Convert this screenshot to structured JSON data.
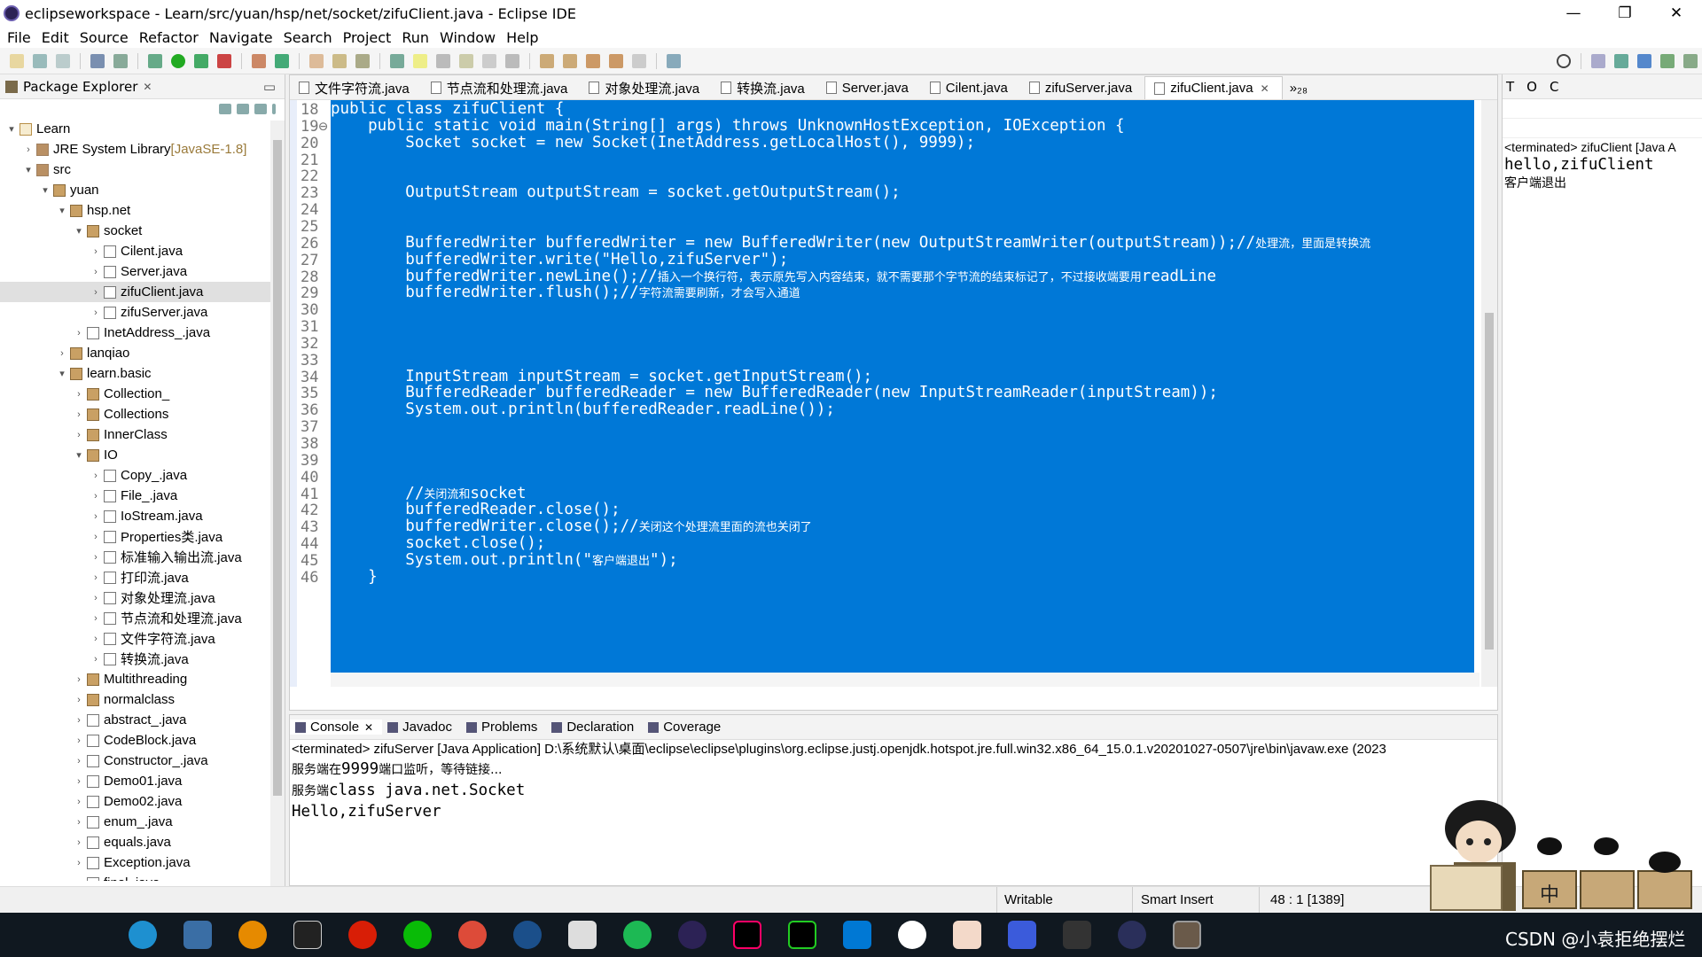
{
  "window": {
    "title": "eclipseworkspace - Learn/src/yuan/hsp/net/socket/zifuClient.java - Eclipse IDE",
    "minimize": "—",
    "restore": "❐",
    "close": "✕"
  },
  "menu": [
    "File",
    "Edit",
    "Source",
    "Refactor",
    "Navigate",
    "Search",
    "Project",
    "Run",
    "Window",
    "Help"
  ],
  "package_explorer": {
    "title": "Package Explorer",
    "items": [
      {
        "label": "Learn",
        "depth": 0,
        "arrow": "▾",
        "icon": "proj"
      },
      {
        "label": "JRE System Library",
        "suffix": " [JavaSE-1.8]",
        "depth": 1,
        "arrow": "›",
        "icon": "jre"
      },
      {
        "label": "src",
        "depth": 1,
        "arrow": "▾",
        "icon": "jre"
      },
      {
        "label": "yuan",
        "depth": 2,
        "arrow": "▾",
        "icon": "pkg"
      },
      {
        "label": "hsp.net",
        "depth": 3,
        "arrow": "▾",
        "icon": "pkg"
      },
      {
        "label": "socket",
        "depth": 4,
        "arrow": "▾",
        "icon": "pkg"
      },
      {
        "label": "Cilent.java",
        "depth": 5,
        "arrow": "›",
        "icon": "java"
      },
      {
        "label": "Server.java",
        "depth": 5,
        "arrow": "›",
        "icon": "java"
      },
      {
        "label": "zifuClient.java",
        "depth": 5,
        "arrow": "›",
        "icon": "java",
        "selected": true
      },
      {
        "label": "zifuServer.java",
        "depth": 5,
        "arrow": "›",
        "icon": "java"
      },
      {
        "label": "InetAddress_.java",
        "depth": 4,
        "arrow": "›",
        "icon": "java"
      },
      {
        "label": "lanqiao",
        "depth": 3,
        "arrow": "›",
        "icon": "pkg"
      },
      {
        "label": "learn.basic",
        "depth": 3,
        "arrow": "▾",
        "icon": "pkg"
      },
      {
        "label": "Collection_",
        "depth": 4,
        "arrow": "›",
        "icon": "pkg"
      },
      {
        "label": "Collections",
        "depth": 4,
        "arrow": "›",
        "icon": "pkg"
      },
      {
        "label": "InnerClass",
        "depth": 4,
        "arrow": "›",
        "icon": "pkg"
      },
      {
        "label": "IO",
        "depth": 4,
        "arrow": "▾",
        "icon": "pkg"
      },
      {
        "label": "Copy_.java",
        "depth": 5,
        "arrow": "›",
        "icon": "java"
      },
      {
        "label": "File_.java",
        "depth": 5,
        "arrow": "›",
        "icon": "java"
      },
      {
        "label": "IoStream.java",
        "depth": 5,
        "arrow": "›",
        "icon": "java"
      },
      {
        "label": "Properties类.java",
        "depth": 5,
        "arrow": "›",
        "icon": "java"
      },
      {
        "label": "标准输入输出流.java",
        "depth": 5,
        "arrow": "›",
        "icon": "java"
      },
      {
        "label": "打印流.java",
        "depth": 5,
        "arrow": "›",
        "icon": "java"
      },
      {
        "label": "对象处理流.java",
        "depth": 5,
        "arrow": "›",
        "icon": "java"
      },
      {
        "label": "节点流和处理流.java",
        "depth": 5,
        "arrow": "›",
        "icon": "java"
      },
      {
        "label": "文件字符流.java",
        "depth": 5,
        "arrow": "›",
        "icon": "java"
      },
      {
        "label": "转换流.java",
        "depth": 5,
        "arrow": "›",
        "icon": "java"
      },
      {
        "label": "Multithreading",
        "depth": 4,
        "arrow": "›",
        "icon": "pkg"
      },
      {
        "label": "normalclass",
        "depth": 4,
        "arrow": "›",
        "icon": "pkg"
      },
      {
        "label": "abstract_.java",
        "depth": 4,
        "arrow": "›",
        "icon": "java"
      },
      {
        "label": "CodeBlock.java",
        "depth": 4,
        "arrow": "›",
        "icon": "java"
      },
      {
        "label": "Constructor_.java",
        "depth": 4,
        "arrow": "›",
        "icon": "java"
      },
      {
        "label": "Demo01.java",
        "depth": 4,
        "arrow": "›",
        "icon": "java"
      },
      {
        "label": "Demo02.java",
        "depth": 4,
        "arrow": "›",
        "icon": "java"
      },
      {
        "label": "enum_.java",
        "depth": 4,
        "arrow": "›",
        "icon": "java"
      },
      {
        "label": "equals.java",
        "depth": 4,
        "arrow": "›",
        "icon": "java"
      },
      {
        "label": "Exception.java",
        "depth": 4,
        "arrow": "›",
        "icon": "java"
      },
      {
        "label": "final .java",
        "depth": 4,
        "arrow": "›",
        "icon": "java"
      }
    ]
  },
  "editor": {
    "tabs": [
      {
        "label": "文件字符流.java"
      },
      {
        "label": "节点流和处理流.java"
      },
      {
        "label": "对象处理流.java"
      },
      {
        "label": "转换流.java"
      },
      {
        "label": "Server.java"
      },
      {
        "label": "Cilent.java"
      },
      {
        "label": "zifuServer.java"
      },
      {
        "label": "zifuClient.java",
        "active": true
      }
    ],
    "overflow": "»₂₈",
    "lines": [
      {
        "n": "18",
        "code": "public class zifuClient {",
        "cm": ""
      },
      {
        "n": "19⊖",
        "code": "    public static void main(String[] args) throws UnknownHostException, IOException {",
        "cm": ""
      },
      {
        "n": "20",
        "code": "        Socket socket = new Socket(InetAddress.getLocalHost(), 9999);",
        "cm": ""
      },
      {
        "n": "21",
        "code": "",
        "cm": ""
      },
      {
        "n": "22",
        "code": "",
        "cm": ""
      },
      {
        "n": "23",
        "code": "        OutputStream outputStream = socket.getOutputStream();",
        "cm": ""
      },
      {
        "n": "24",
        "code": "",
        "cm": ""
      },
      {
        "n": "25",
        "code": "",
        "cm": ""
      },
      {
        "n": "26",
        "code": "        BufferedWriter bufferedWriter = new BufferedWriter(new OutputStreamWriter(outputStream));//",
        "cm": "处理流，里面是转换流"
      },
      {
        "n": "27",
        "code": "        bufferedWriter.write(\"Hello,zifuServer\");",
        "cm": ""
      },
      {
        "n": "28",
        "code": "        bufferedWriter.newLine();//",
        "cm": "插入一个换行符，表示原先写入内容结束，就不需要那个字节流的结束标记了，不过接收端要用",
        "tail": "readLine"
      },
      {
        "n": "29",
        "code": "        bufferedWriter.flush();//",
        "cm": "字符流需要刷新，才会写入通道"
      },
      {
        "n": "30",
        "code": "",
        "cm": ""
      },
      {
        "n": "31",
        "code": "",
        "cm": ""
      },
      {
        "n": "32",
        "code": "",
        "cm": ""
      },
      {
        "n": "33",
        "code": "",
        "cm": ""
      },
      {
        "n": "34",
        "code": "        InputStream inputStream = socket.getInputStream();",
        "cm": ""
      },
      {
        "n": "35",
        "code": "        BufferedReader bufferedReader = new BufferedReader(new InputStreamReader(inputStream));",
        "cm": ""
      },
      {
        "n": "36",
        "code": "        System.out.println(bufferedReader.readLine());",
        "cm": ""
      },
      {
        "n": "37",
        "code": "",
        "cm": ""
      },
      {
        "n": "38",
        "code": "",
        "cm": ""
      },
      {
        "n": "39",
        "code": "",
        "cm": ""
      },
      {
        "n": "40",
        "code": "",
        "cm": ""
      },
      {
        "n": "41",
        "code": "        //",
        "cm": "关闭流和",
        "tail": "socket"
      },
      {
        "n": "42",
        "code": "        bufferedReader.close();",
        "cm": ""
      },
      {
        "n": "43",
        "code": "        bufferedWriter.close();//",
        "cm": "关闭这个处理流里面的流也关闭了"
      },
      {
        "n": "44",
        "code": "        socket.close();",
        "cm": ""
      },
      {
        "n": "45",
        "code": "        System.out.println(\"",
        "cm": "客户端退出",
        "tail": "\");"
      },
      {
        "n": "46",
        "code": "    }",
        "cm": ""
      }
    ]
  },
  "right_panel": {
    "tabs": [
      "T",
      "O",
      "C"
    ],
    "terminated": "<terminated> zifuClient [Java A",
    "out1": "hello,zifuClient",
    "out2": "客户端退出"
  },
  "console": {
    "tabs": [
      {
        "label": "Console",
        "active": true
      },
      {
        "label": "Javadoc"
      },
      {
        "label": "Problems"
      },
      {
        "label": "Declaration"
      },
      {
        "label": "Coverage"
      }
    ],
    "terminated": "<terminated> zifuServer [Java Application] D:\\系统默认\\桌面\\eclipse\\eclipse\\plugins\\org.eclipse.justj.openjdk.hotspot.jre.full.win32.x86_64_15.0.1.v20201027-0507\\jre\\bin\\javaw.exe  (2023",
    "l1_cm": "服务端在",
    "l1_code": "9999",
    "l1_cm2": "端口监听，等待链接...",
    "l2_cm": "服务端",
    "l2_code": "class java.net.Socket",
    "l3_code": "Hello,zifuServer"
  },
  "status": {
    "writable": "Writable",
    "insert": "Smart Insert",
    "pos": "48 : 1 [1389]"
  },
  "taskbar": {
    "ime": "中",
    "watermark": "CSDN @小袁拒绝摆烂"
  },
  "colors": {
    "selection": "#0078d7",
    "taskbar": "#101820"
  }
}
